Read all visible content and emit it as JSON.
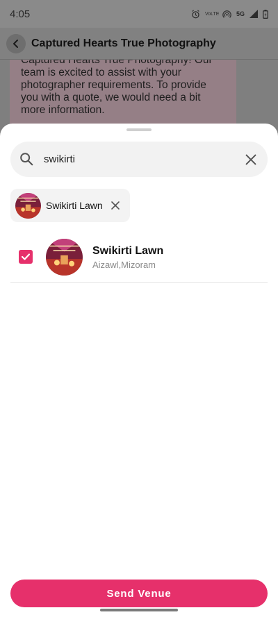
{
  "status_bar": {
    "time": "4:05",
    "network_label": "5G",
    "volte_label": "VoLTE",
    "icons": [
      "alarm-icon",
      "volte-icon",
      "hotspot-icon",
      "network-icon",
      "signal-icon",
      "battery-icon"
    ]
  },
  "chat": {
    "title": "Captured Hearts True Photography",
    "message": "Captured Hearts True Photography! Our team is excited to assist with your photographer requirements. To provide you with a quote, we would need a bit more information."
  },
  "sheet": {
    "search": {
      "value": "swikirti",
      "placeholder": ""
    },
    "selected_chips": [
      {
        "label": "Swikirti Lawn"
      }
    ],
    "results": [
      {
        "name": "Swikirti Lawn",
        "location": "Aizawl,Mizoram",
        "checked": true
      }
    ],
    "send_label": "Send Venue"
  },
  "colors": {
    "accent": "#e6306b",
    "scrim": "#7f7f7f",
    "sheet_bg": "#ffffff",
    "chip_bg": "#f3f3f3"
  }
}
